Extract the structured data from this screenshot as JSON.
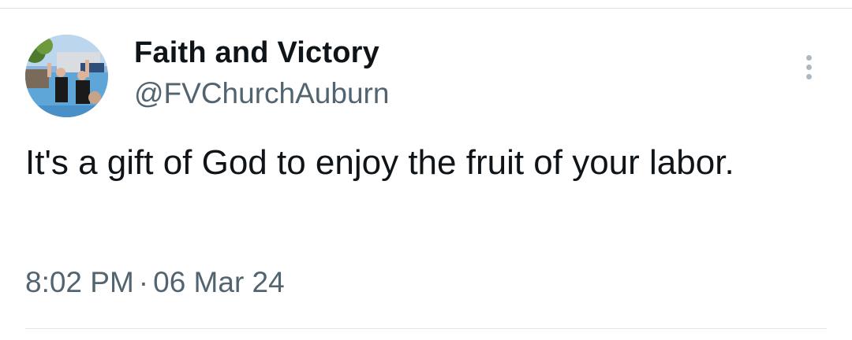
{
  "tweet": {
    "display_name": "Faith and Victory",
    "handle": "@FVChurchAuburn",
    "text": "It's a gift of God to enjoy the fruit of your labor.",
    "time": "8:02 PM",
    "separator": "·",
    "date": "06 Mar 24",
    "avatar_icon": "profile-photo-icon",
    "more_icon": "vertical-ellipsis-icon"
  },
  "colors": {
    "text_primary": "#0f1419",
    "text_secondary": "#536471",
    "divider": "#dfe3e6",
    "more_dots": "#aeb8c1"
  }
}
